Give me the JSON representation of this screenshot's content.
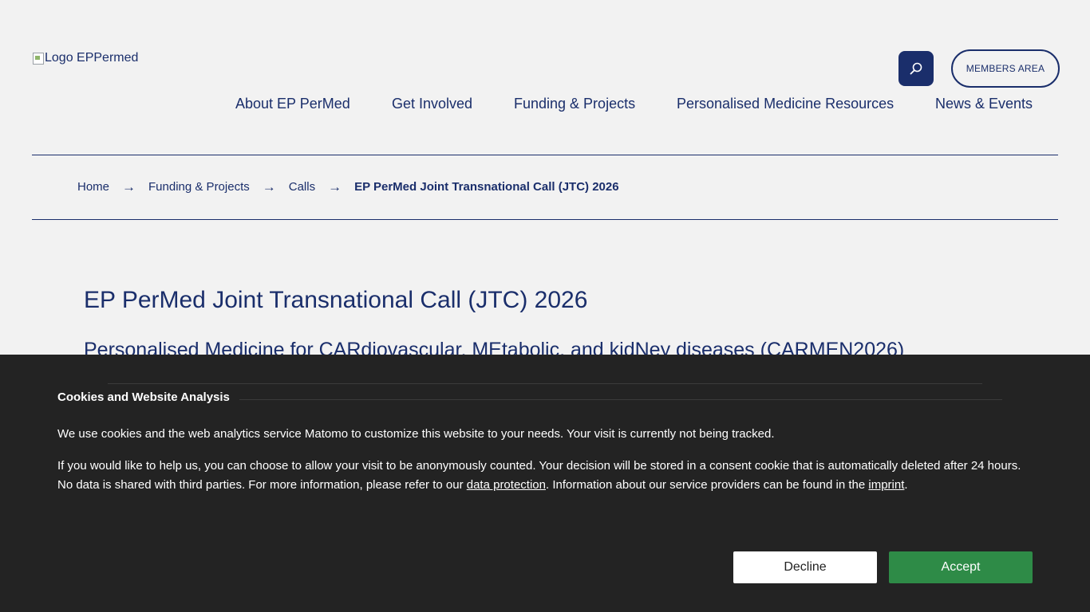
{
  "header": {
    "logo_alt": "Logo EPPermed",
    "search_icon": "search-icon",
    "members_area_label": "MEMBERS AREA"
  },
  "nav": {
    "items": [
      {
        "label": "About EP PerMed"
      },
      {
        "label": "Get Involved"
      },
      {
        "label": "Funding & Projects"
      },
      {
        "label": "Personalised Medicine Resources"
      },
      {
        "label": "News & Events"
      }
    ]
  },
  "breadcrumb": {
    "items": [
      {
        "label": "Home"
      },
      {
        "label": "Funding & Projects"
      },
      {
        "label": "Calls"
      }
    ],
    "separator": "→",
    "current": "EP PerMed Joint Transnational Call (JTC) 2026"
  },
  "main": {
    "title": "EP PerMed Joint Transnational Call (JTC) 2026",
    "subtitle": "Personalised Medicine for CARdiovascular, MEtabolic, and kidNey diseases (CARMEN2026)"
  },
  "cookie_banner": {
    "title": "Cookies and Website Analysis",
    "paragraph1": "We use cookies and the web analytics service Matomo to customize this website to your needs. Your visit is currently not being tracked.",
    "paragraph2_part1": "If you would like to help us, you can choose to allow your visit to be anonymously counted. Your decision will be stored in a consent cookie that is automatically deleted after 24 hours. No data is shared with third parties. For more information, please refer to our ",
    "data_protection_link": "data protection",
    "paragraph2_part2": ". Information about our service providers can be found in the ",
    "imprint_link": "imprint",
    "paragraph2_part3": ".",
    "decline_label": "Decline",
    "accept_label": "Accept"
  },
  "colors": {
    "brand_navy": "#1a2e6b",
    "page_bg": "#f2f2f2",
    "banner_bg": "#232323",
    "accept_green": "#2e8b47"
  }
}
